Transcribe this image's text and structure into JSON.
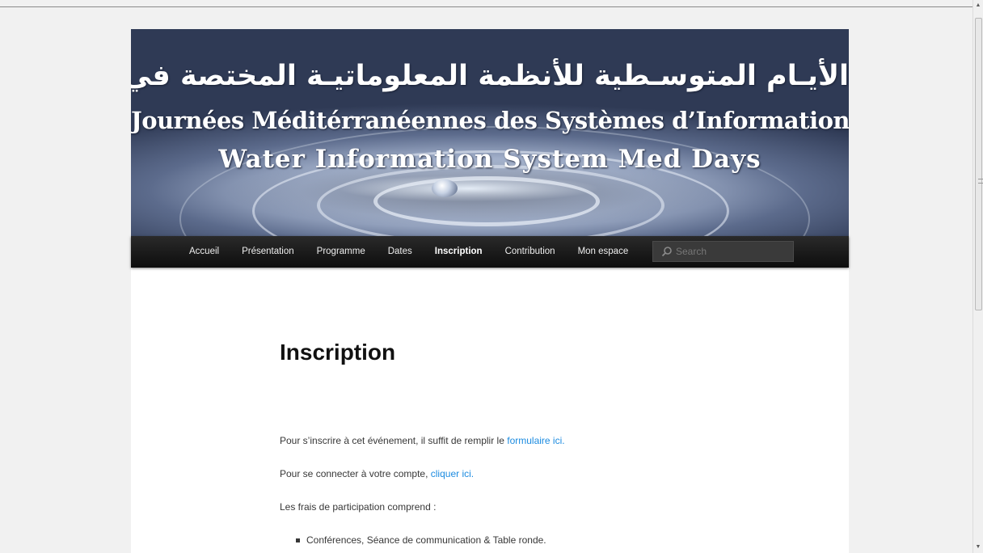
{
  "banner": {
    "arabic_title": "الأيـام المتوسـطية للأنظمة المعلوماتيـة المختصة في المجال المائي",
    "french_title": "Journées Méditérranéennes des Systèmes d’Informations de l’Eau",
    "english_title": "Water Information System Med Days"
  },
  "nav": {
    "items": [
      {
        "label": "Accueil"
      },
      {
        "label": "Présentation"
      },
      {
        "label": "Programme"
      },
      {
        "label": "Dates"
      },
      {
        "label": "Inscription"
      },
      {
        "label": "Contribution"
      },
      {
        "label": "Mon espace"
      }
    ],
    "active": "Inscription",
    "search": {
      "placeholder": "Search",
      "icon": "search-icon"
    }
  },
  "content": {
    "title": "Inscription",
    "p1": {
      "text": "Pour s’inscrire à cet événement, il suffit de remplir le ",
      "link": "formulaire ici."
    },
    "p2": {
      "text": "Pour se connecter à votre compte, ",
      "link": "cliquer ici."
    },
    "p3": {
      "text": "Les frais de participation comprend :"
    },
    "bullets": [
      "Conférences, Séance de communication & Table ronde."
    ]
  },
  "colors": {
    "link": "#1b8be0",
    "nav_bg": "#111111",
    "page_bg": "#f1f1f1"
  }
}
